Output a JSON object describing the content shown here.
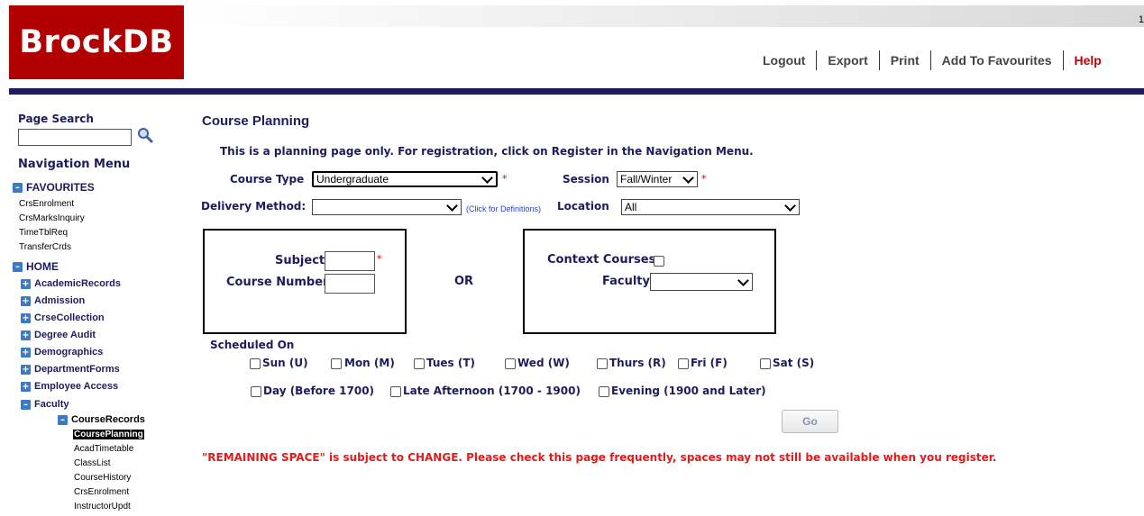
{
  "header": {
    "logo_text": "BrockDB",
    "corner_text": "1",
    "links": {
      "logout": "Logout",
      "export": "Export",
      "print": "Print",
      "add_fav": "Add To Favourites",
      "help": "Help"
    }
  },
  "sidebar": {
    "page_search_label": "Page Search",
    "page_search_value": "",
    "nav_menu_label": "Navigation Menu",
    "favourites": {
      "label": "FAVOURITES",
      "items": [
        "CrsEnrolment",
        "CrsMarksInquiry",
        "TimeTblReq",
        "TransferCrds"
      ]
    },
    "home": {
      "label": "HOME",
      "items": [
        "AcademicRecords",
        "Admission",
        "CrseCollection",
        "Degree Audit",
        "Demographics",
        "DepartmentForms",
        "Employee Access",
        "Faculty"
      ],
      "faculty_sub": {
        "label": "CourseRecords",
        "items": [
          "CoursePlanning",
          "AcadTimetable",
          "ClassList",
          "CourseHistory",
          "CrsEnrolment",
          "InstructorUpdt"
        ],
        "selected": "CoursePlanning"
      }
    }
  },
  "main": {
    "title": "Course Planning",
    "info": "This is a planning page only. For registration, click on Register in the Navigation Menu.",
    "course_type_label": "Course Type",
    "course_type_value": "Undergraduate",
    "session_label": "Session",
    "session_value": "Fall/Winter",
    "delivery_label": "Delivery Method:",
    "delivery_value": "",
    "definitions_link": "(Click for Definitions)",
    "location_label": "Location",
    "location_value": "All",
    "required_mark": "*",
    "subject_label": "Subject",
    "course_number_label": "Course Number",
    "or_text": "OR",
    "context_label": "Context Courses",
    "faculty_label": "Faculty",
    "faculty_value": "",
    "scheduled_on_label": "Scheduled On",
    "days": [
      "Sun (U)",
      "Mon (M)",
      "Tues (T)",
      "Wed (W)",
      "Thurs (R)",
      "Fri (F)",
      "Sat (S)"
    ],
    "times": [
      "Day (Before 1700)",
      "Late Afternoon (1700 - 1900)",
      "Evening (1900 and Later)"
    ],
    "go_label": "Go",
    "warning": "\"REMAINING SPACE\" is subject to CHANGE. Please check this page frequently, spaces may not still be available when you register."
  }
}
